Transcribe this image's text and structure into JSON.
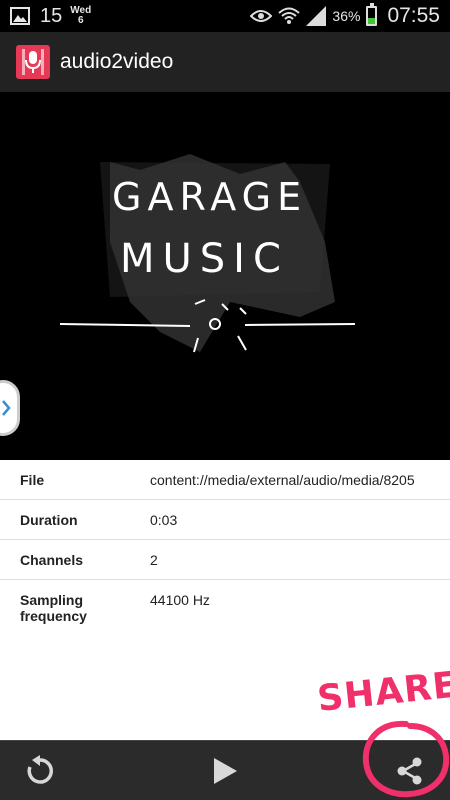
{
  "status_bar": {
    "day": "15",
    "weekday": "Wed",
    "weekday_num": "6",
    "battery_percent": "36%",
    "time": "07:55",
    "icons": [
      "image-icon",
      "eye-icon",
      "wifi-icon",
      "signal-icon",
      "battery-icon"
    ]
  },
  "app": {
    "title": "audio2video",
    "icon": "microphone-icon",
    "accent": "#e53955"
  },
  "artwork": {
    "line1": "GARAGE",
    "line2": "MUSIC"
  },
  "info": {
    "rows": [
      {
        "label": "File",
        "value": "content://media/external/audio/media/8205"
      },
      {
        "label": "Duration",
        "value": "0:03"
      },
      {
        "label": "Channels",
        "value": "2"
      },
      {
        "label": "Sampling frequency",
        "value": "44100 Hz"
      }
    ]
  },
  "annotation": {
    "text": "SHARE",
    "color": "#f0306a"
  },
  "bottom_bar": {
    "buttons": [
      "replay-icon",
      "play-icon",
      "share-icon"
    ]
  }
}
